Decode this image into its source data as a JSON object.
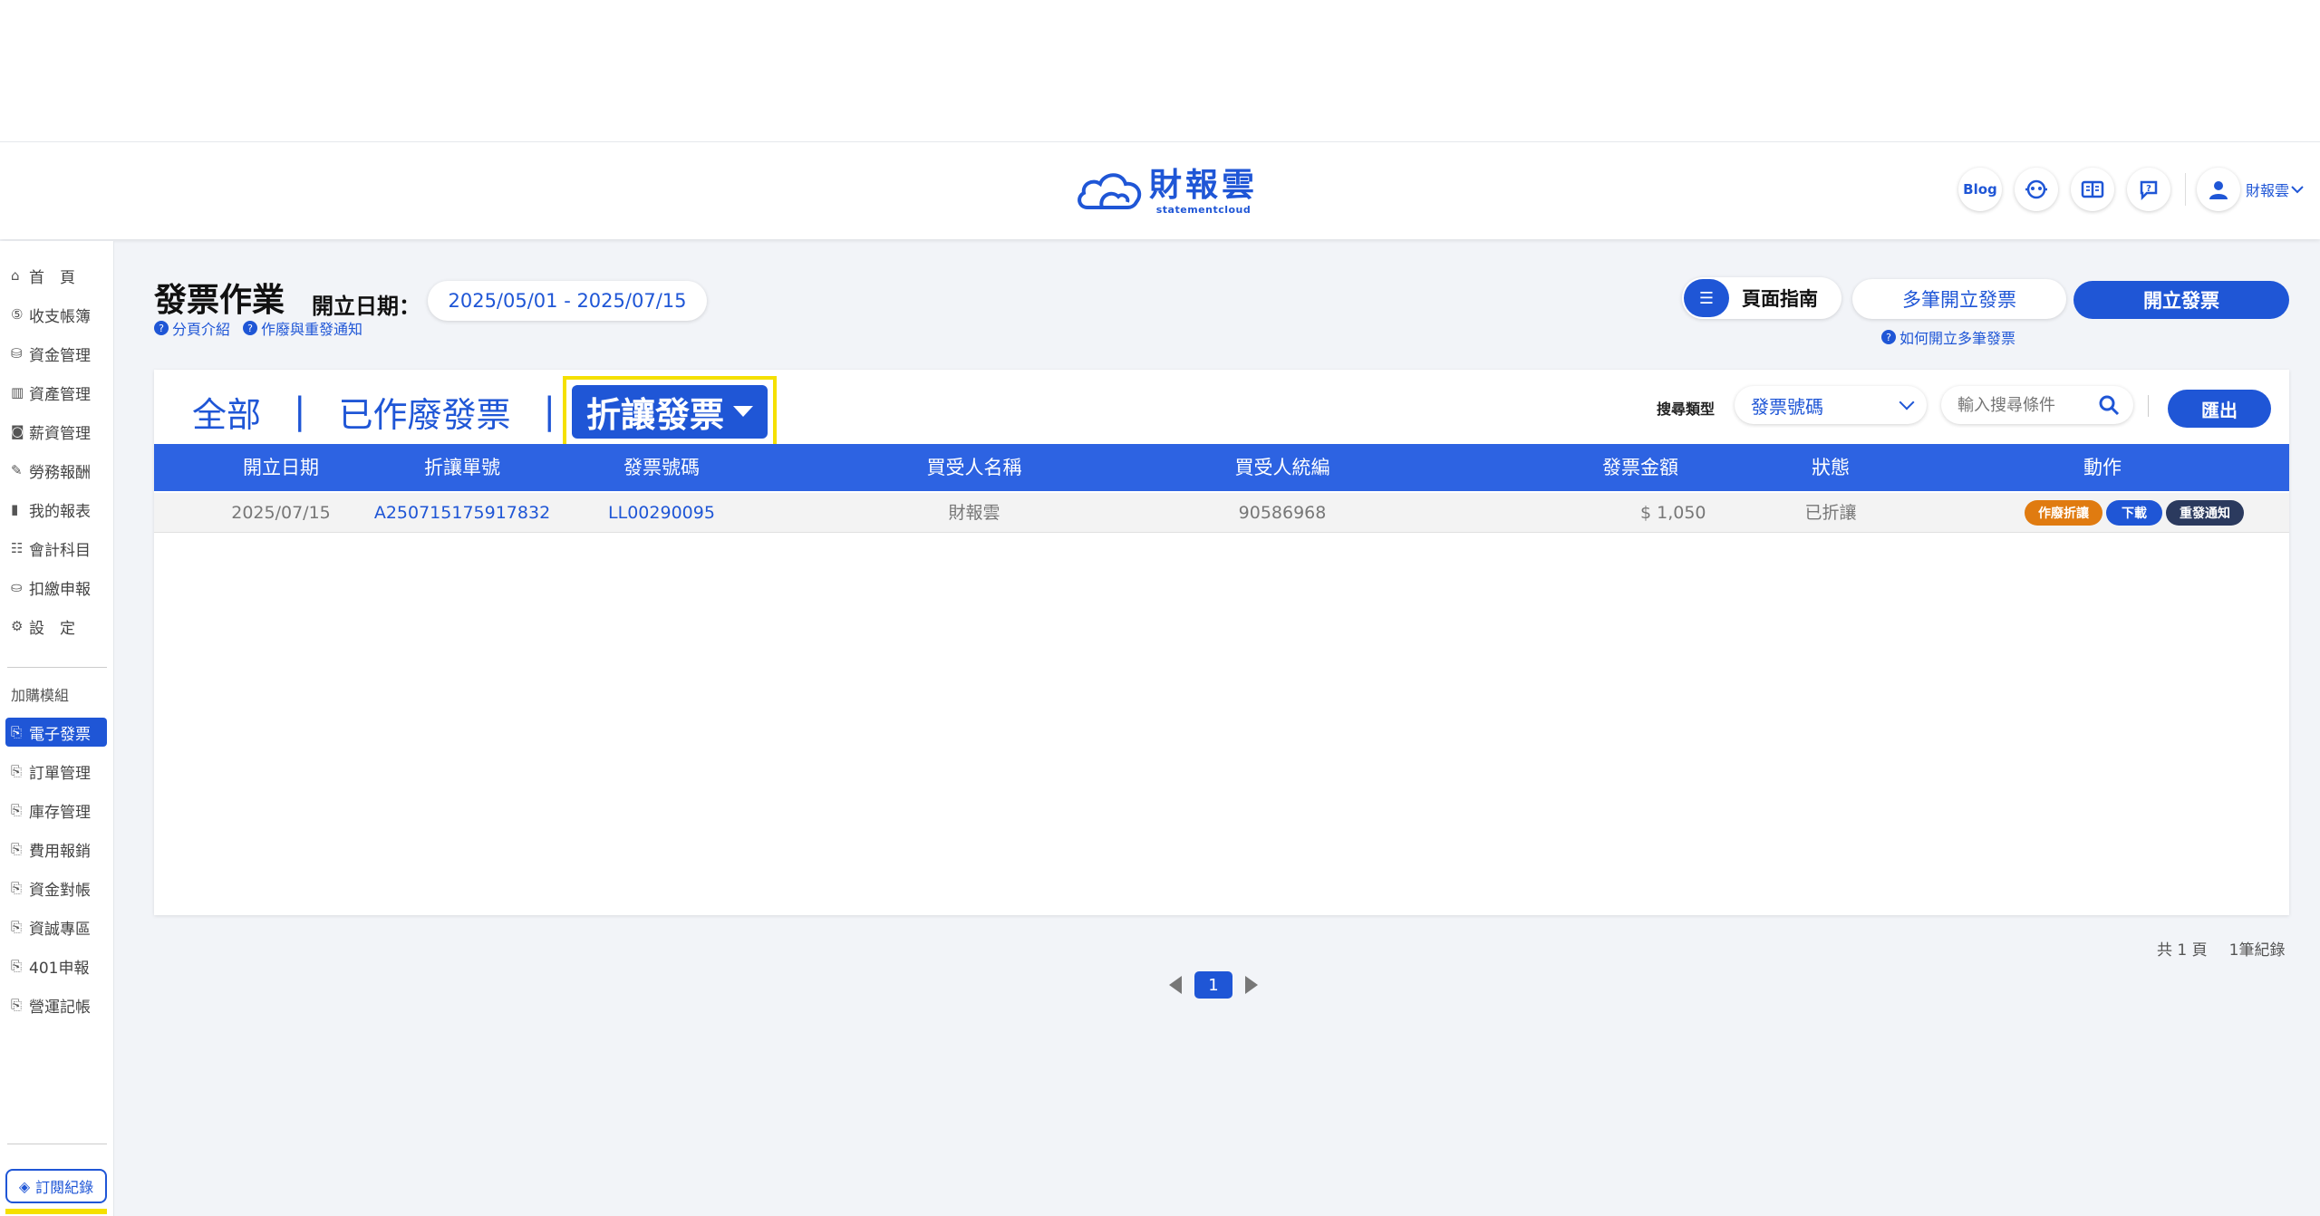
{
  "header": {
    "logo_main": "財報雲",
    "logo_sub": "statementcloud",
    "blog_label": "Blog",
    "user_name": "財報雲"
  },
  "sidebar": {
    "items": [
      {
        "icon": "home-icon",
        "glyph": "⌂",
        "label": "首　頁"
      },
      {
        "icon": "income-icon",
        "glyph": "⑤",
        "label": "收支帳簿"
      },
      {
        "icon": "fund-icon",
        "glyph": "⛁",
        "label": "資金管理"
      },
      {
        "icon": "asset-icon",
        "glyph": "▥",
        "label": "資產管理"
      },
      {
        "icon": "salary-icon",
        "glyph": "◙",
        "label": "薪資管理"
      },
      {
        "icon": "labor-icon",
        "glyph": "✎",
        "label": "勞務報酬"
      },
      {
        "icon": "report-icon",
        "glyph": "▮",
        "label": "我的報表"
      },
      {
        "icon": "account-icon",
        "glyph": "☷",
        "label": "會計科目"
      },
      {
        "icon": "tax-icon",
        "glyph": "⛀",
        "label": "扣繳申報"
      },
      {
        "icon": "settings-icon",
        "glyph": "⚙",
        "label": "設　定"
      }
    ],
    "addon_title": "加購模組",
    "addons": [
      {
        "label": "電子發票",
        "active": true
      },
      {
        "label": "訂單管理"
      },
      {
        "label": "庫存管理"
      },
      {
        "label": "費用報銷"
      },
      {
        "label": "資金對帳"
      },
      {
        "label": "資誠專區"
      },
      {
        "label": "401申報"
      },
      {
        "label": "營運記帳"
      }
    ],
    "subscription": "訂閱紀錄"
  },
  "page": {
    "title": "發票作業",
    "date_label": "開立日期：",
    "date_range": "2025/05/01 - 2025/07/15",
    "help_1": "分頁介紹",
    "help_2": "作廢與重發通知",
    "guide": "頁面指南",
    "multi_open": "多筆開立發票",
    "multi_help": "如何開立多筆發票",
    "open": "開立發票"
  },
  "tabs": {
    "all": "全部",
    "void": "已作廢發票",
    "discount": "折讓發票"
  },
  "search": {
    "type_label": "搜尋類型",
    "type_value": "發票號碼",
    "placeholder": "輸入搜尋條件",
    "export": "匯出"
  },
  "table": {
    "headers": [
      "開立日期",
      "折讓單號",
      "發票號碼",
      "買受人名稱",
      "買受人統編",
      "發票金額",
      "狀態",
      "動作"
    ],
    "rows": [
      {
        "date": "2025/07/15",
        "discount_no": "A250715175917832",
        "invoice_no": "LL00290095",
        "buyer": "財報雲",
        "tax_id": "90586968",
        "amount": "$ 1,050",
        "status": "已折讓",
        "actions": {
          "void": "作廢折讓",
          "download": "下載",
          "resend": "重發通知"
        }
      }
    ]
  },
  "pager": {
    "pages": "共 1 頁",
    "records": "1筆紀錄",
    "current": "1"
  },
  "colors": {
    "primary": "#1f56d6",
    "header_row": "#2d63e2",
    "void_action": "#e07b10",
    "download_action": "#1f56d6",
    "resend_action": "#2b3a5e",
    "highlight": "#f5e000"
  }
}
